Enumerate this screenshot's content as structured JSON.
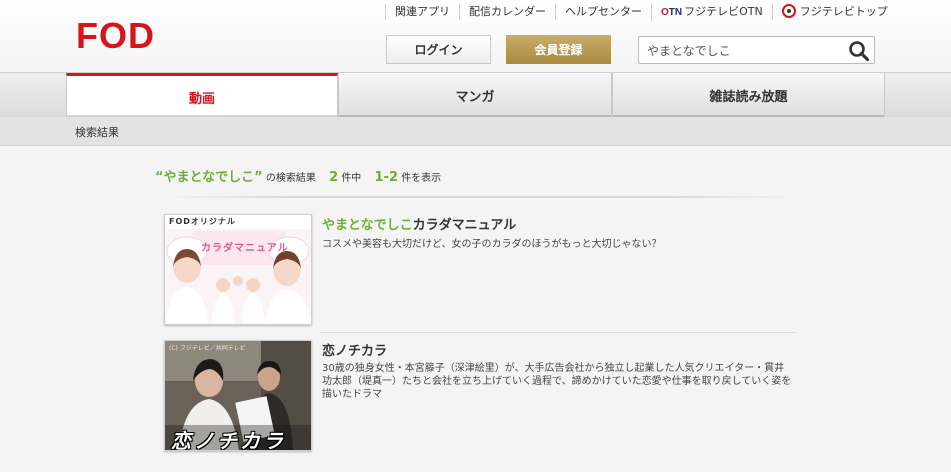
{
  "header": {
    "logo": "FOD",
    "top_links": [
      {
        "label": "関連アプリ"
      },
      {
        "label": "配信カレンダー"
      },
      {
        "label": "ヘルプセンター"
      },
      {
        "label": "フジテレビOTN",
        "badge": "OTN"
      },
      {
        "label": "フジテレビトップ"
      }
    ],
    "login_label": "ログイン",
    "register_label": "会員登録",
    "search_value": "やまとなでしこ"
  },
  "nav": {
    "tabs": [
      {
        "label": "動画",
        "active": true
      },
      {
        "label": "マンガ",
        "active": false
      },
      {
        "label": "雑誌読み放題",
        "active": false
      }
    ]
  },
  "breadcrumb": "検索結果",
  "summary": {
    "query": "“やまとなでしこ”",
    "label_results": "の検索結果",
    "total": "2",
    "label_total": "件中",
    "range": "1-2",
    "label_range": "件を表示"
  },
  "results": [
    {
      "title_highlight": "やまとなでしこ",
      "title_rest": "カラダマニュアル",
      "description": "コスメや美容も大切だけど、女の子のカラダのほうがもっと大切じゃない？",
      "thumb_label": "FODオリジナル",
      "thumb_title": "カラダマニュアル"
    },
    {
      "title_highlight": "",
      "title_rest": "恋ノチカラ",
      "description": "30歳の独身女性・本宮籐子（深津絵里）が、大手広告会社から独立し起業した人気クリエイター・貫井功太郎（堤真一）たちと会社を立ち上げていく過程で、諦めかけていた恋愛や仕事を取り戻していく姿を描いたドラマ",
      "thumb_label": "(C) フジテレビ／共同テレビ",
      "thumb_title": "恋ノチカラ"
    }
  ],
  "colors": {
    "brand_red": "#d7131c",
    "accent_green": "#6eaf31",
    "gold": "#b89a52"
  }
}
